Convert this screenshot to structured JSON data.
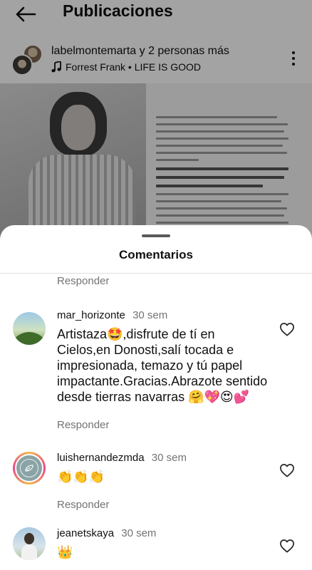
{
  "topbar": {
    "title": "Publicaciones"
  },
  "post": {
    "author": "labelmontemarta y 2 personas más",
    "music": "Forrest Frank • LIFE IS GOOD"
  },
  "sheet": {
    "title": "Comentarios"
  },
  "reply_label": "Responder",
  "comments": [
    {
      "username": "mar_horizonte",
      "time": "30 sem",
      "text": "Artistaza🤩,disfrute de tí en Cielos,en Donosti,salí  tocada e impresionada, temazo y tú papel impactante.Gracias.Abrazote sentido desde tierras navarras 🤗💖😍💕"
    },
    {
      "username": "luishernandezmda",
      "time": "30 sem",
      "text": "👏👏👏"
    },
    {
      "username": "jeanetskaya",
      "time": "30 sem",
      "text": "👑"
    }
  ]
}
